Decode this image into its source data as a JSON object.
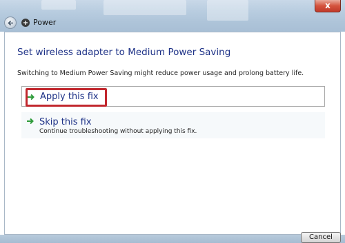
{
  "window": {
    "title": "Power",
    "close_label": "x"
  },
  "page": {
    "heading": "Set wireless adapter to Medium Power Saving",
    "description": "Switching to Medium Power Saving might reduce power usage and prolong battery life."
  },
  "options": {
    "apply": {
      "label": "Apply this fix",
      "icon": "green-arrow-icon"
    },
    "skip": {
      "label": "Skip this fix",
      "sublabel": "Continue troubleshooting without applying this fix.",
      "icon": "green-arrow-icon"
    }
  },
  "footer": {
    "cancel_label": "Cancel"
  },
  "colors": {
    "heading": "#1e3287",
    "highlight": "#c1272d",
    "arrow": "#2e9b3a"
  }
}
